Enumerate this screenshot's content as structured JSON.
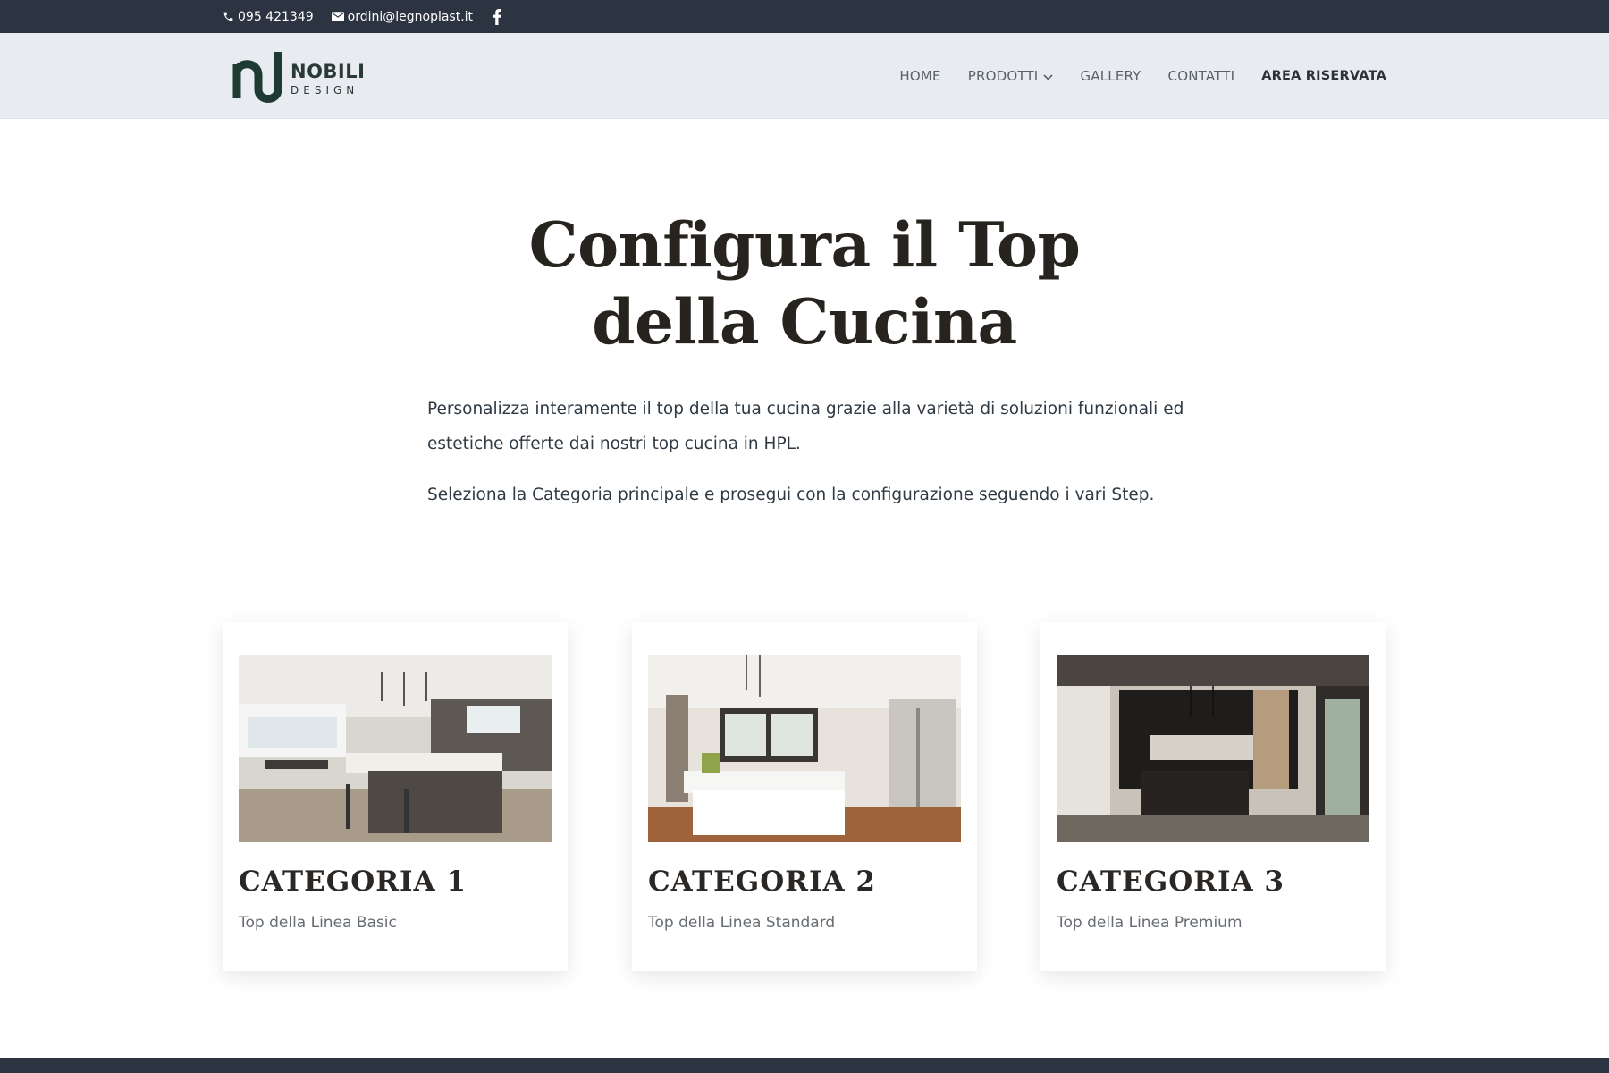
{
  "topbar": {
    "phone": "095 421349",
    "email": "ordini@legnoplast.it"
  },
  "logo": {
    "name": "NOBILI",
    "sub": "DESIGN"
  },
  "nav": {
    "items": [
      {
        "label": "HOME"
      },
      {
        "label": "PRODOTTI"
      },
      {
        "label": "GALLERY"
      },
      {
        "label": "CONTATTI"
      },
      {
        "label": "AREA RISERVATA"
      }
    ]
  },
  "hero": {
    "title_line1": "Configura il Top",
    "title_line2": "della Cucina",
    "paragraph1": "Personalizza interamente il top della tua cucina grazie alla varietà di soluzioni funzionali ed estetiche offerte dai nostri top cucina in HPL.",
    "paragraph2": "Seleziona la Categoria principale e prosegui con la configurazione seguendo i vari Step."
  },
  "cards": [
    {
      "title": "CATEGORIA 1",
      "subtitle": "Top della Linea Basic"
    },
    {
      "title": "CATEGORIA 2",
      "subtitle": "Top della Linea Standard"
    },
    {
      "title": "CATEGORIA 3",
      "subtitle": "Top della Linea Premium"
    }
  ],
  "colors": {
    "topbar_bg": "#2b3440",
    "header_bg": "#e8ecf0",
    "title_color": "#27231f",
    "logo_color": "#2a3a36"
  },
  "icons": {
    "phone": "phone-icon",
    "email": "envelope-icon",
    "social": "facebook-icon",
    "dropdown": "chevron-down-icon"
  }
}
